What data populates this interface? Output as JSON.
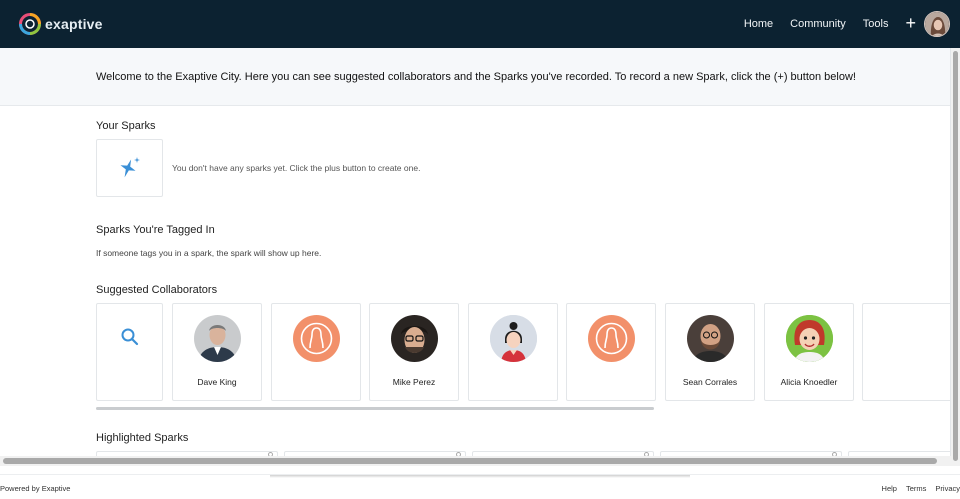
{
  "brand": {
    "name": "exaptive",
    "logo_icon": "exaptive-logo-icon"
  },
  "nav": {
    "links": [
      "Home",
      "Community",
      "Tools"
    ],
    "plus_label": "+",
    "avatar_icon": "user-avatar"
  },
  "welcome": {
    "text": "Welcome to the Exaptive City. Here you can see suggested collaborators and the Sparks you've recorded. To record a new Spark, click the (+) button below!"
  },
  "your_sparks": {
    "title": "Your Sparks",
    "empty_text": "You don't have any sparks yet. Click the plus button to create one.",
    "icon": "sparkle-icon"
  },
  "tagged": {
    "title": "Sparks You're Tagged In",
    "text": "If someone tags you in a spark, the spark will show up here."
  },
  "collaborators": {
    "title": "Suggested Collaborators",
    "search_icon": "search-icon",
    "people": [
      {
        "name": "Dave King",
        "avatar": "photo"
      },
      {
        "name": "",
        "avatar": "default-orange"
      },
      {
        "name": "Mike Perez",
        "avatar": "photo"
      },
      {
        "name": "",
        "avatar": "illustrated-woman"
      },
      {
        "name": "",
        "avatar": "default-orange"
      },
      {
        "name": "Sean Corrales",
        "avatar": "photo"
      },
      {
        "name": "Alicia Knoedler",
        "avatar": "cartoon"
      }
    ]
  },
  "highlighted": {
    "title": "Highlighted Sparks"
  },
  "footer": {
    "powered_by": "Powered by Exaptive",
    "links": [
      "Help",
      "Terms",
      "Privacy"
    ]
  },
  "colors": {
    "nav_bg": "#0c2231",
    "accent_blue": "#3a8fd6",
    "default_avatar_orange": "#f2906a",
    "welcome_bg": "#f6f8fa"
  }
}
